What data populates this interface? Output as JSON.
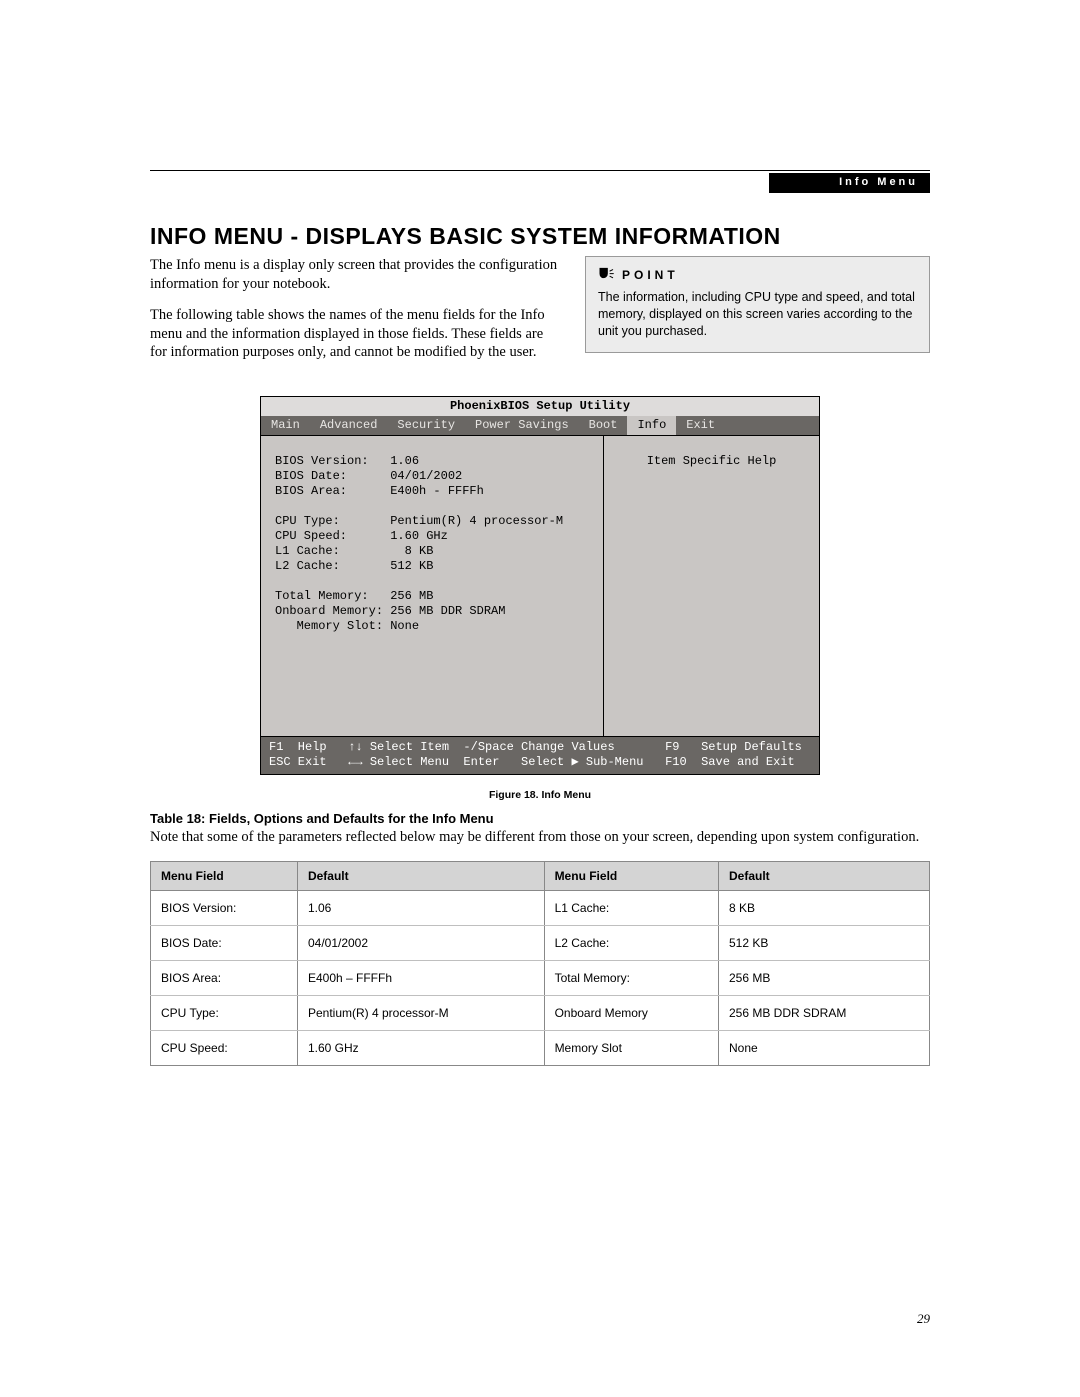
{
  "header": {
    "section_label": "Info Menu"
  },
  "title": "INFO MENU - DISPLAYS BASIC SYSTEM INFORMATION",
  "intro": {
    "p1": "The Info menu is a display only screen that provides the configuration information for your notebook.",
    "p2": "The following table shows the names of the menu fields for the Info menu and the information displayed in those fields. These fields are for information purposes only, and cannot be modified by the user."
  },
  "point": {
    "label": "POINT",
    "body": "The information, including CPU type and speed, and total memory, displayed on this screen varies according to the unit you purchased."
  },
  "bios": {
    "title": "PhoenixBIOS Setup Utility",
    "tabs": [
      "Main",
      "Advanced",
      "Security",
      "Power Savings",
      "Boot",
      "Info",
      "Exit"
    ],
    "active_tab": "Info",
    "help_title": "Item Specific Help",
    "fields": [
      {
        "label": "BIOS Version:",
        "value": "1.06"
      },
      {
        "label": "BIOS Date:",
        "value": "04/01/2002"
      },
      {
        "label": "BIOS Area:",
        "value": "E400h - FFFFh"
      },
      {
        "label": "",
        "value": ""
      },
      {
        "label": "CPU Type:",
        "value": "Pentium(R) 4 processor-M"
      },
      {
        "label": "CPU Speed:",
        "value": "1.60 GHz"
      },
      {
        "label": "L1 Cache:",
        "value": "  8 KB"
      },
      {
        "label": "L2 Cache:",
        "value": "512 KB"
      },
      {
        "label": "",
        "value": ""
      },
      {
        "label": "Total Memory:",
        "value": "256 MB"
      },
      {
        "label": "Onboard Memory:",
        "value": "256 MB DDR SDRAM"
      },
      {
        "label": "   Memory Slot:",
        "value": "None"
      }
    ],
    "footer": {
      "l1": "F1  Help   ↑↓ Select Item  -/Space Change Values       F9   Setup Defaults",
      "l2": "ESC Exit   ←→ Select Menu  Enter   Select ▶ Sub-Menu   F10  Save and Exit"
    }
  },
  "figure_caption": "Figure 18.  Info Menu",
  "table": {
    "title": "Table 18: Fields, Options and Defaults for the Info Menu",
    "note": "Note that some of the parameters reflected below may be different from those on your screen, depending upon system configuration.",
    "headers": [
      "Menu Field",
      "Default",
      "Menu Field",
      "Default"
    ],
    "rows": [
      [
        "BIOS Version:",
        "1.06",
        "L1 Cache:",
        "8 KB"
      ],
      [
        "BIOS Date:",
        "04/01/2002",
        "L2 Cache:",
        "512 KB"
      ],
      [
        "BIOS Area:",
        "E400h – FFFFh",
        "Total Memory:",
        "256 MB"
      ],
      [
        "CPU Type:",
        "Pentium(R) 4 processor-M",
        "Onboard Memory",
        "256 MB DDR SDRAM"
      ],
      [
        "CPU Speed:",
        "1.60 GHz",
        "Memory Slot",
        "None"
      ]
    ]
  },
  "page_number": "29"
}
